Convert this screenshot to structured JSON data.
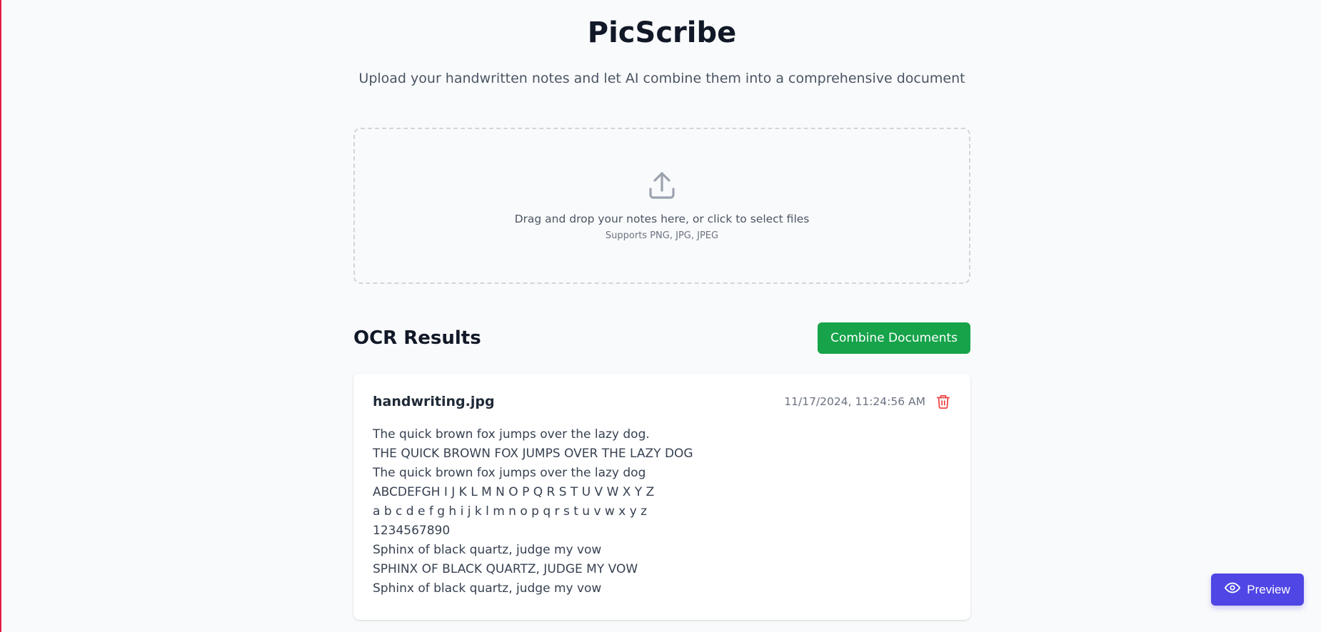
{
  "app": {
    "title": "PicScribe",
    "subtitle": "Upload your handwritten notes and let AI combine them into a comprehensive document"
  },
  "dropzone": {
    "icon": "upload-icon",
    "main_text": "Drag and drop your notes here, or click to select files",
    "sub_text": "Supports PNG, JPG, JPEG"
  },
  "results": {
    "title": "OCR Results",
    "combine_label": "Combine Documents",
    "items": [
      {
        "filename": "handwriting.jpg",
        "timestamp": "11/17/2024, 11:24:56 AM",
        "lines": [
          "The quick brown fox jumps over the lazy dog.",
          "THE QUICK BROWN FOX JUMPS OVER THE LAZY DOG",
          "The quick brown fox jumps over the lazy dog",
          "ABCDEFGH I J K L M N O P Q R S T U V W X Y Z",
          "a b c d e f g h i j k l m n o p q r s t u v w x y z",
          "1234567890",
          "Sphinx of black quartz, judge my vow",
          "SPHINX OF BLACK QUARTZ, JUDGE MY VOW",
          "Sphinx of black quartz, judge my vow"
        ]
      }
    ]
  },
  "preview": {
    "label": "Preview",
    "icon": "eye-icon"
  },
  "colors": {
    "accent_green": "#16a34a",
    "accent_indigo": "#4f46e5",
    "delete_red": "#ef4444",
    "background": "#f9fafb"
  }
}
